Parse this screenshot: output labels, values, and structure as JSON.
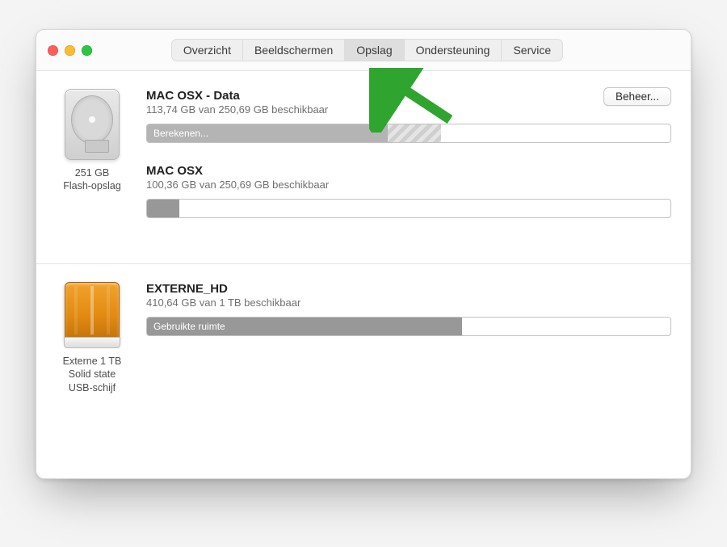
{
  "tabs": {
    "overview": "Overzicht",
    "displays": "Beeldschermen",
    "storage": "Opslag",
    "support": "Ondersteuning",
    "service": "Service",
    "active": "storage"
  },
  "manage_button_label": "Beheer...",
  "drives": {
    "internal": {
      "label_line1": "251 GB",
      "label_line2": "Flash-opslag"
    },
    "external": {
      "label_line1": "Externe 1 TB",
      "label_line2": "Solid state",
      "label_line3": "USB-schijf"
    }
  },
  "volumes": {
    "data": {
      "name": "MAC OSX - Data",
      "subtitle": "113,74 GB van 250,69 GB beschikbaar",
      "segment_label": "Berekenen...",
      "used_pct": 46,
      "hatch_pct": 9
    },
    "system": {
      "name": "MAC OSX",
      "subtitle": "100,36 GB van 250,69 GB beschikbaar",
      "used_pct": 5
    },
    "ext": {
      "name": "EXTERNE_HD",
      "subtitle": "410,64 GB van 1 TB beschikbaar",
      "segment_label": "Gebruikte ruimte",
      "used_pct": 59
    }
  },
  "annotation_arrow_color": "#2fa52f"
}
